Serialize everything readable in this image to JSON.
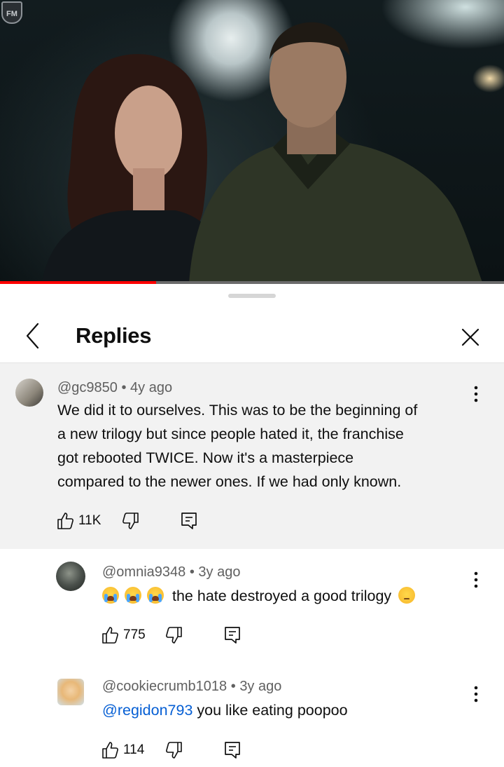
{
  "video": {
    "logo_text": "FM",
    "progress_fraction": 0.31
  },
  "header": {
    "title": "Replies"
  },
  "comments": [
    {
      "author": "@gc9850",
      "age": "4y ago",
      "text_lines": [
        "We did it to ourselves. This was to be the beginning of",
        "a new trilogy but since people hated it, the franchise",
        "got rebooted TWICE. Now it's a masterpiece",
        "compared to the newer ones. If we had only known."
      ],
      "likes": "11K"
    },
    {
      "author": "@omnia9348",
      "age": "3y ago",
      "text": "the hate destroyed a good trilogy",
      "emojis_before": [
        "loudly-crying-face",
        "loudly-crying-face",
        "loudly-crying-face"
      ],
      "emoji_after": "pensive-face",
      "likes": "775"
    },
    {
      "author": "@cookiecrumb1018",
      "age": "3y ago",
      "mention": "@regidon793",
      "text": " you like eating poopoo",
      "likes": "114"
    }
  ],
  "separator": " • ",
  "colors": {
    "accent_red": "#ff0000",
    "link_blue": "#065fd4",
    "highlight_bg": "#f2f2f2",
    "meta_gray": "#606060"
  }
}
